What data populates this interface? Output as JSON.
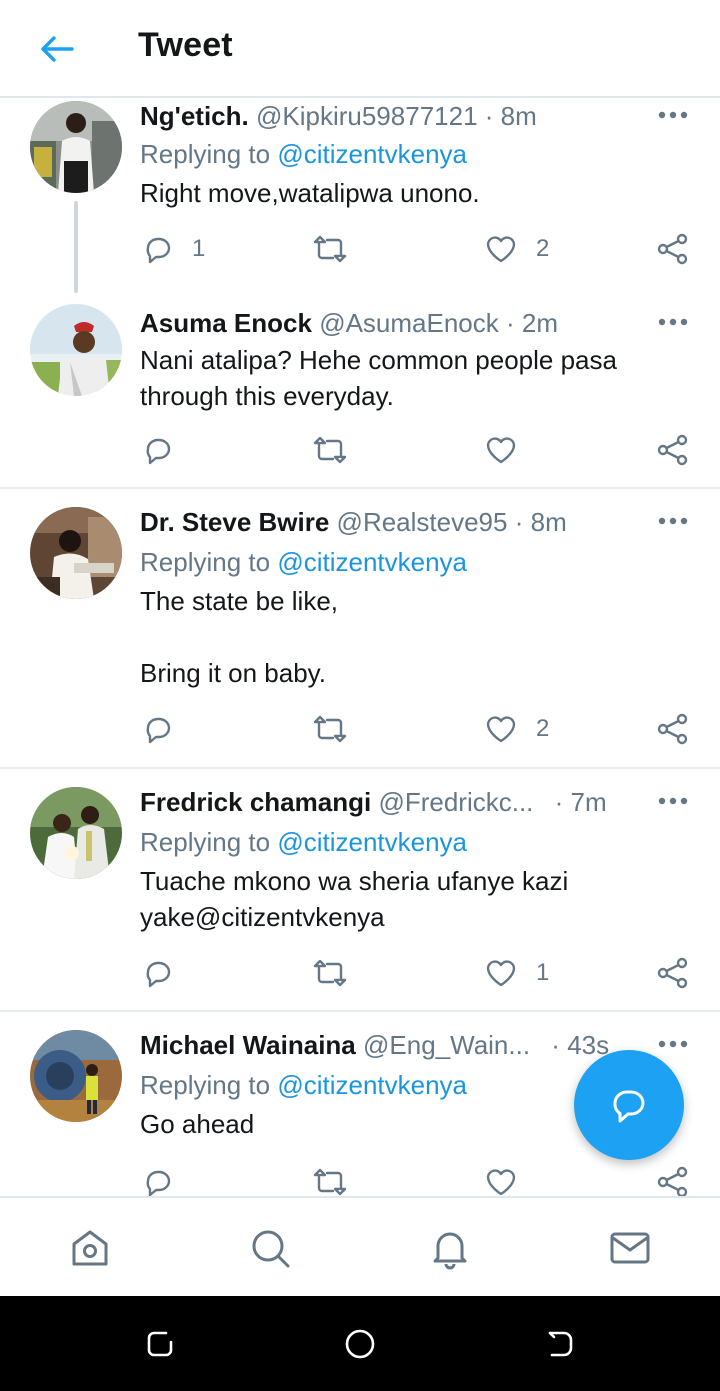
{
  "header": {
    "title": "Tweet",
    "back_icon": "arrow-left-icon",
    "accent": "#1da1f2"
  },
  "tweets": [
    {
      "name": "Ng'etich.",
      "handle": "@Kipkiru59877121",
      "dot": "·",
      "time": "8m",
      "replying_prefix": "Replying to",
      "replying_to": "@citizentvkenya",
      "text": "Right move,watalipwa unono.",
      "replies": "1",
      "retweets": "",
      "likes": "2"
    },
    {
      "name": "Asuma Enock",
      "handle": "@AsumaEnock",
      "dot": "·",
      "time": "2m",
      "text": "Nani atalipa? Hehe common people pasa through this everyday.",
      "replies": "",
      "retweets": "",
      "likes": ""
    },
    {
      "name": "Dr. Steve Bwire",
      "handle": "@Realsteve95",
      "dot": "·",
      "time": "8m",
      "replying_prefix": "Replying to",
      "replying_to": "@citizentvkenya",
      "text": "The state be like,\n\nBring it on baby.",
      "replies": "",
      "retweets": "",
      "likes": "2"
    },
    {
      "name": "Fredrick chamangi",
      "handle": "@Fredrickc...",
      "dot": "·",
      "time": "7m",
      "replying_prefix": "Replying to",
      "replying_to": "@citizentvkenya",
      "text": "Tuache mkono wa sheria ufanye kazi yake@citizentvkenya",
      "replies": "",
      "retweets": "",
      "likes": "1"
    },
    {
      "name": "Michael Wainaina",
      "handle": "@Eng_Wain...",
      "dot": "·",
      "time": "43s",
      "replying_prefix": "Replying to",
      "replying_to": "@citizentvkenya",
      "text": "Go ahead",
      "replies": "",
      "retweets": "",
      "likes": ""
    }
  ],
  "fab": {
    "icon": "compose-reply-icon"
  },
  "bottom_nav": [
    "home-icon",
    "search-icon",
    "notifications-bell-icon",
    "messages-mail-icon"
  ],
  "system_nav": [
    "recent-apps-icon",
    "home-circle-icon",
    "back-icon"
  ]
}
